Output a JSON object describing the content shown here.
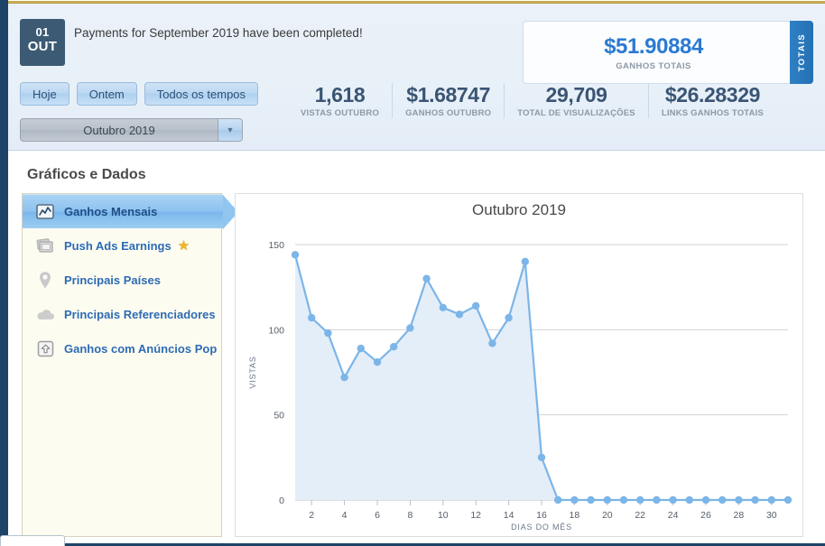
{
  "header": {
    "date_badge": {
      "day": "01",
      "month": "OUT"
    },
    "notice": "Payments for September 2019 have been completed!",
    "range_buttons": [
      {
        "label": "Hoje"
      },
      {
        "label": "Ontem"
      },
      {
        "label": "Todos os tempos"
      }
    ],
    "month_select": {
      "value": "Outubro 2019",
      "arrow_icon": "chevron-down-icon"
    },
    "stats": [
      {
        "value": "1,618",
        "label": "VISTAS OUTUBRO"
      },
      {
        "value": "$1.68747",
        "label": "GANHOS OUTUBRO"
      },
      {
        "value": "29,709",
        "label": "TOTAL DE VISUALIZAÇÕES"
      },
      {
        "value": "$26.28329",
        "label": "LINKS GANHOS TOTAIS"
      }
    ],
    "totals_card": {
      "value": "$51.90884",
      "label": "GANHOS TOTAIS",
      "tab_label": "TOTAIS"
    }
  },
  "section": {
    "title": "Gráficos e Dados"
  },
  "sidebar": {
    "items": [
      {
        "label": "Ganhos Mensais",
        "icon": "line-chart-icon",
        "active": true,
        "star": false
      },
      {
        "label": "Push Ads Earnings",
        "icon": "images-stack-icon",
        "active": false,
        "star": true
      },
      {
        "label": "Principais Países",
        "icon": "map-pin-icon",
        "active": false,
        "star": false
      },
      {
        "label": "Principais Referenciadores",
        "icon": "cloud-icon",
        "active": false,
        "star": false
      },
      {
        "label": "Ganhos com Anúncios Pop",
        "icon": "popup-arrow-icon",
        "active": false,
        "star": false
      }
    ]
  },
  "colors": {
    "accent_blue": "#2b7ad1",
    "line_blue": "#7cb5e8",
    "area_fill": "#e4eef9",
    "dark_navy": "#1d4468",
    "sidebar_cream": "#fdfcf0",
    "gold_rule": "#b99a36"
  },
  "chart_data": {
    "type": "area",
    "title": "Outubro 2019",
    "xlabel": "DIAS DO MÊS",
    "ylabel": "VISTAS",
    "ylim": [
      0,
      150
    ],
    "yticks": [
      0,
      50,
      100,
      150
    ],
    "xticks": [
      2,
      4,
      6,
      8,
      10,
      12,
      14,
      16,
      18,
      20,
      22,
      24,
      26,
      28,
      30
    ],
    "xlim": [
      1,
      31
    ],
    "grid": true,
    "legend": "none",
    "x": [
      1,
      2,
      3,
      4,
      5,
      6,
      7,
      8,
      9,
      10,
      11,
      12,
      13,
      14,
      15,
      16,
      17,
      18,
      19,
      20,
      21,
      22,
      23,
      24,
      25,
      26,
      27,
      28,
      29,
      30,
      31
    ],
    "values": [
      144,
      107,
      98,
      72,
      89,
      81,
      90,
      101,
      130,
      113,
      109,
      114,
      92,
      107,
      140,
      25,
      0,
      0,
      0,
      0,
      0,
      0,
      0,
      0,
      0,
      0,
      0,
      0,
      0,
      0,
      0
    ],
    "series": [
      {
        "name": "VISTAS",
        "values": [
          144,
          107,
          98,
          72,
          89,
          81,
          90,
          101,
          130,
          113,
          109,
          114,
          92,
          107,
          140,
          25,
          0,
          0,
          0,
          0,
          0,
          0,
          0,
          0,
          0,
          0,
          0,
          0,
          0,
          0,
          0
        ]
      }
    ]
  }
}
